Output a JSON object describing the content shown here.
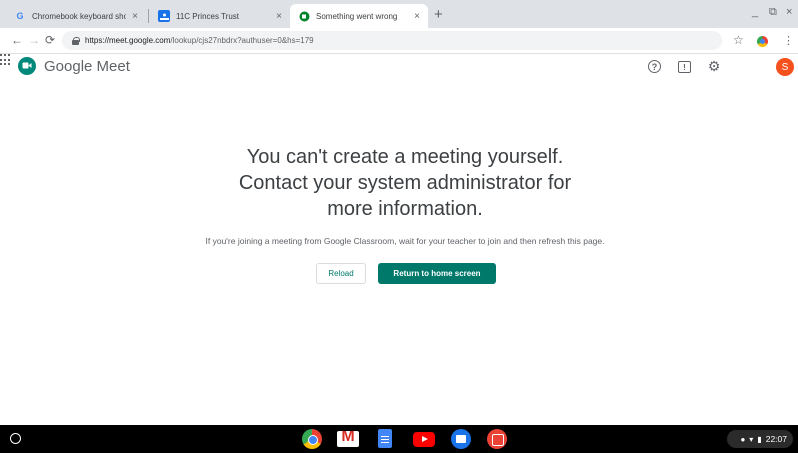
{
  "browser": {
    "tabs": [
      {
        "title": "Chromebook keyboard shortcut",
        "icon": "google-g-icon",
        "active": false
      },
      {
        "title": "11C Princes Trust",
        "icon": "classroom-icon",
        "active": false
      },
      {
        "title": "Something went wrong",
        "icon": "meet-icon",
        "active": true
      }
    ],
    "new_tab_label": "+",
    "address": {
      "host": "https://meet.google.com",
      "path": "/lookup/cjs27nbdrx?authuser=0&hs=179"
    }
  },
  "meet": {
    "brand": "Google Meet",
    "avatar_initial": "S",
    "avatar_color": "#f4511e"
  },
  "main": {
    "headline": [
      "You can't create a meeting yourself.",
      "Contact your system administrator for",
      "more information."
    ],
    "subtext": "If you're joining a meeting from Google Classroom, wait for your teacher to join and then refresh this page.",
    "reload_label": "Reload",
    "home_label": "Return to home screen",
    "accent_color": "#00796b"
  },
  "shelf": {
    "apps": [
      "chrome-icon",
      "gmail-icon",
      "docs-icon",
      "youtube-icon",
      "files-icon",
      "gallery-icon"
    ],
    "time": "22:07"
  }
}
